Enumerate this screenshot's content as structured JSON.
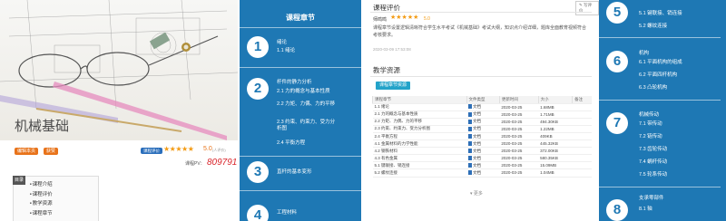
{
  "course": {
    "title": "机械基础",
    "tags": [
      "编辑本页",
      "获赞"
    ],
    "eval_badge": "课程评价",
    "stars": "★★★★★",
    "score": "5.0",
    "score_sub": "(人评价)",
    "pv_label": "课程PV：",
    "pv_value": "809791",
    "toc_tag": "目录",
    "toc": [
      "课程介绍",
      "课程评价",
      "教学资源",
      "课程章节"
    ]
  },
  "chapters": {
    "title": "课程章节",
    "items": [
      {
        "num": "1",
        "head": "绪论",
        "subs": [
          "1.1 绪论"
        ]
      },
      {
        "num": "2",
        "head": "杆件的静力分析",
        "subs": [
          "2.1 力的概念与基本性质",
          "2.2 力矩、力偶、力的平移",
          "2.3 约束、约束力、受力分析图",
          "2.4 平衡方程"
        ]
      },
      {
        "num": "3",
        "head": "直杆的基本变形",
        "subs": []
      },
      {
        "num": "4",
        "head": "工程材料",
        "subs": []
      }
    ]
  },
  "evaluation": {
    "heading": "课程评价",
    "write_btn": "写评价",
    "reviewer": "师鸣鸣",
    "stars": "★★★★★",
    "score": "5.0",
    "text": "课程章节设置逻辑清晰符合学生水平考试《机械基础》考试大纲，知识点介绍详细，题库全面教育视频符合考核要求。",
    "date": "2020-03-09 17:53:08"
  },
  "resources": {
    "heading": "教学资源",
    "button": "课程章节资源",
    "columns": [
      "课程章节",
      "文件类型",
      "更新时间",
      "大小",
      "备注"
    ],
    "rows": [
      [
        "1.1 绪论",
        "文档",
        "2020-03-25",
        "1.68MB",
        ""
      ],
      [
        "2.1 力的概念与基本性质",
        "文档",
        "2020-03-25",
        "1.71MB",
        ""
      ],
      [
        "2.2 力矩、力偶、力的平移",
        "文档",
        "2020-03-25",
        "494.30KB",
        ""
      ],
      [
        "2.3 约束、约束力、受力分析图",
        "文档",
        "2020-03-25",
        "1.22MB",
        ""
      ],
      [
        "2.4 平衡方程",
        "文档",
        "2020-03-25",
        "409KB",
        ""
      ],
      [
        "4.1 金属材料的力学性能",
        "文档",
        "2020-03-25",
        "445.32KB",
        ""
      ],
      [
        "4.2 钢铁材料",
        "文档",
        "2020-03-25",
        "372.00KB",
        ""
      ],
      [
        "4.3 有色金属",
        "文档",
        "2020-03-25",
        "580.35KB",
        ""
      ],
      [
        "5.1 键联接、销连接",
        "文档",
        "2020-03-25",
        "15.09MB",
        ""
      ],
      [
        "5.2 螺纹连接",
        "文档",
        "2020-03-25",
        "1.04MB",
        ""
      ]
    ],
    "more": "更多"
  },
  "chapters2": {
    "items": [
      {
        "num": "5",
        "head": "",
        "subs": [
          "5.1 键联接、销连接",
          "5.2 螺纹连接"
        ]
      },
      {
        "num": "6",
        "head": "机构",
        "subs": [
          "6.1 平面机构的组成",
          "6.2 平面四杆机构",
          "6.3 凸轮机构"
        ]
      },
      {
        "num": "7",
        "head": "机械传动",
        "subs": [
          "7.1 带传动",
          "7.2 链传动",
          "7.3 齿轮传动",
          "7.4 蜗杆传动",
          "7.5 轮系传动"
        ]
      },
      {
        "num": "8",
        "head": "支承零部件",
        "subs": [
          "8.1 轴"
        ]
      }
    ]
  },
  "colors": {
    "blue": "#1e78b4",
    "orange": "#e8731a",
    "star": "#f39b14",
    "red": "#d9242a",
    "teal": "#23a3c9"
  }
}
